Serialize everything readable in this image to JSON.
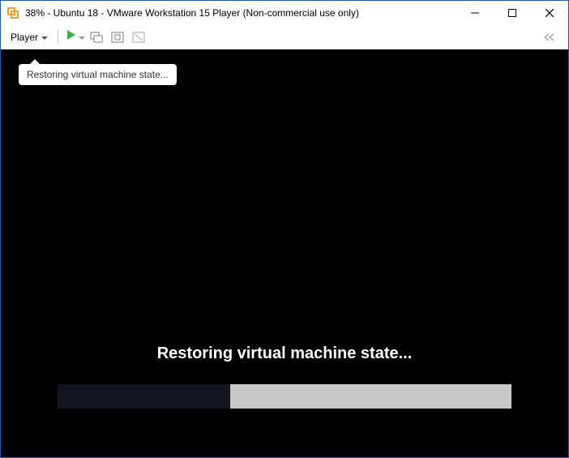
{
  "titlebar": {
    "title": "38% - Ubuntu 18 - VMware Workstation 15 Player (Non-commercial use only)"
  },
  "toolbar": {
    "player_label": "Player"
  },
  "tooltip": {
    "text": "Restoring virtual machine state..."
  },
  "main": {
    "status_text": "Restoring virtual machine state...",
    "progress_percent": 38
  }
}
